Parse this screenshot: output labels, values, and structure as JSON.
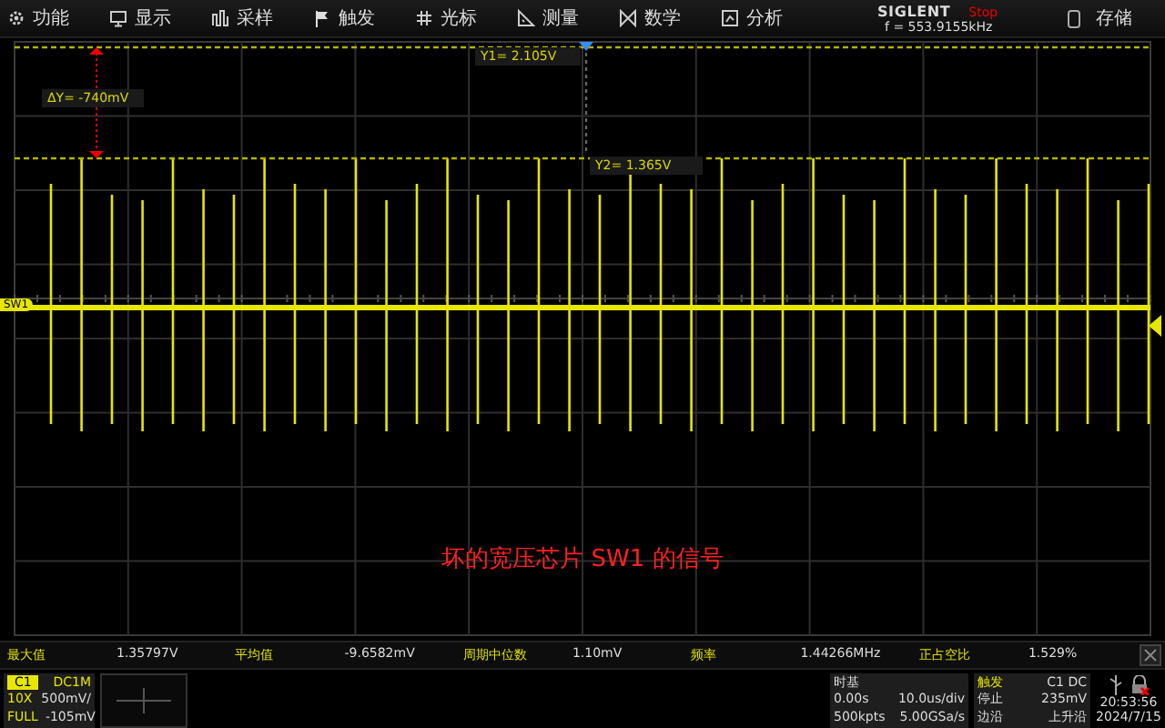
{
  "menu": [
    {
      "kind": "gear",
      "label": "功能"
    },
    {
      "kind": "display",
      "label": "显示"
    },
    {
      "kind": "acquire",
      "label": "采样"
    },
    {
      "kind": "flag",
      "label": "触发"
    },
    {
      "kind": "cursor",
      "label": "光标"
    },
    {
      "kind": "measure",
      "label": "测量"
    },
    {
      "kind": "math",
      "label": "数学"
    },
    {
      "kind": "analyze",
      "label": "分析"
    }
  ],
  "brand": "SIGLENT",
  "run_state": "Stop",
  "frequency": "f = 553.9155kHz",
  "save": "存储",
  "cursors": {
    "delta": "ΔY= -740mV",
    "y1": "Y1= 2.105V",
    "y2": "Y2= 1.365V"
  },
  "channel_marker": "SW1",
  "caption": "坏的宽压芯片 SW1 的信号",
  "measurements": [
    {
      "label": "最大值",
      "value": "1.35797V"
    },
    {
      "label": "平均值",
      "value": "-9.6582mV"
    },
    {
      "label": "周期中位数",
      "value": "1.10mV"
    },
    {
      "label": "频率",
      "value": "1.44266MHz"
    },
    {
      "label": "正占空比",
      "value": "1.529%"
    }
  ],
  "channel": {
    "name": "C1",
    "coupling": "DC1M",
    "probe": "10X",
    "scale": "500mV/",
    "bandwidth": "FULL",
    "offset": "-105mV"
  },
  "timebase": {
    "title": "时基",
    "delay": "0.00s",
    "scale": "10.0us/div",
    "memory": "500kpts",
    "sample_rate": "5.00GSa/s"
  },
  "trigger": {
    "title": "触发",
    "source": "C1 DC",
    "state": "停止",
    "level": "235mV",
    "type": "边沿",
    "slope": "上升沿"
  },
  "clock": {
    "time": "20:53:56",
    "date": "2024/7/15"
  }
}
